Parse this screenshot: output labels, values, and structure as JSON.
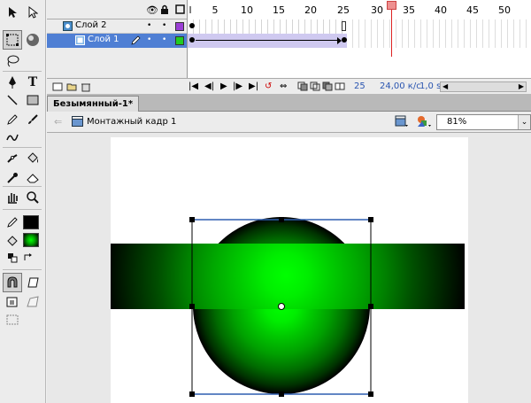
{
  "timeline": {
    "layers": [
      {
        "name": "Слой 2",
        "color": "#9b3fd6"
      },
      {
        "name": "Слой 1",
        "color": "#22cc22"
      }
    ],
    "ruler_numbers": [
      "l",
      "5",
      "10",
      "15",
      "20",
      "25",
      "30",
      "35",
      "40",
      "45",
      "50"
    ],
    "status": {
      "frame": "25",
      "fps": "24,00 к/с",
      "time": "1,0 s"
    }
  },
  "document": {
    "tab_title": "Безымянный-1*",
    "scene_name": "Монтажный кадр 1",
    "zoom": "81%"
  },
  "colors": {
    "stroke": "#000000",
    "fill": "#00ff00",
    "selection": "#2f5fb0"
  },
  "tools": [
    "selection-arrow",
    "subselection-arrow",
    "free-transform",
    "gradient-transform",
    "lasso",
    "pen",
    "text",
    "line",
    "rectangle",
    "pencil",
    "brush",
    "deco",
    "bone",
    "paint-bucket",
    "eyedropper",
    "eraser",
    "hand",
    "zoom",
    "snap-magnet",
    "smooth",
    "straighten"
  ]
}
